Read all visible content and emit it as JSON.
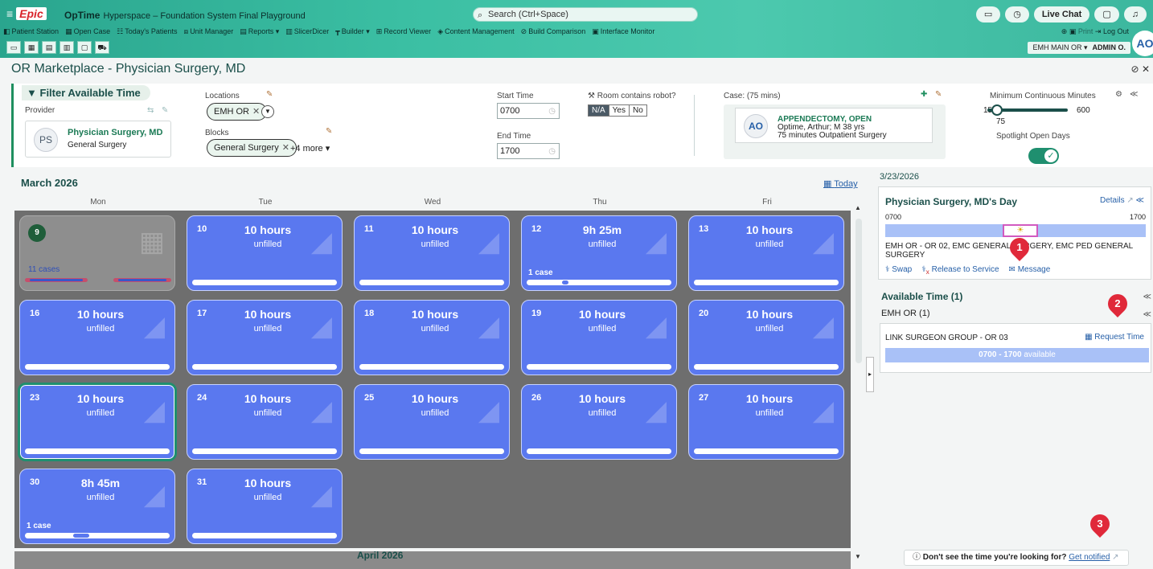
{
  "header": {
    "menu_icon": "≡",
    "logo": "Epic",
    "app_name": "OpTime",
    "app_subtitle": "Hyperspace – Foundation System Final Playground",
    "search_placeholder": "Search (Ctrl+Space)",
    "live_chat": "Live Chat",
    "nav": [
      "Patient Station",
      "Open Case",
      "Today's Patients",
      "Unit Manager",
      "Reports ▾",
      "SlicerDicer",
      "Builder ▾",
      "Record Viewer",
      "Content Management",
      "Build Comparison",
      "Interface Monitor"
    ],
    "print": "Print",
    "logout": "Log Out",
    "department": "EMH MAIN OR ▾",
    "user": "ADMIN O.",
    "avatar_initials": "AO"
  },
  "page": {
    "title": "OR Marketplace - Physician Surgery, MD"
  },
  "filter": {
    "title": "Filter Available Time",
    "provider_label": "Provider",
    "provider_initials": "PS",
    "provider_name": "Physician Surgery, MD",
    "provider_specialty": "General Surgery",
    "locations_label": "Locations",
    "location_chip": "EMH OR",
    "blocks_label": "Blocks",
    "block_chip": "General Surgery",
    "blocks_more": "+4 more ▾",
    "start_time_label": "Start Time",
    "start_time": "0700",
    "end_time_label": "End Time",
    "end_time": "1700",
    "robot_label": "Room contains robot?",
    "robot_options": [
      "N/A",
      "Yes",
      "No"
    ],
    "robot_selected": "N/A",
    "case_label": "Case: (75 mins)",
    "case_initials": "AO",
    "case_title": "APPENDECTOMY, OPEN",
    "case_patient": "Optime, Arthur; M 38 yrs",
    "case_detail": "75 minutes Outpatient Surgery",
    "min_cont_label": "Minimum Continuous Minutes",
    "min_value": "15",
    "max_value": "600",
    "current_value": "75",
    "slider_level": 0.12,
    "spotlight_label": "Spotlight Open Days",
    "spotlight_on": true
  },
  "calendar": {
    "month": "March 2026",
    "today": "Today",
    "weekdays": [
      "Mon",
      "Tue",
      "Wed",
      "Thu",
      "Fri"
    ],
    "days": [
      {
        "num": "9",
        "past": true,
        "cases": "11 cases"
      },
      {
        "num": "10",
        "hours": "10 hours",
        "status": "unfilled"
      },
      {
        "num": "11",
        "hours": "10 hours",
        "status": "unfilled"
      },
      {
        "num": "12",
        "hours": "9h 25m",
        "status": "unfilled",
        "cases": "1 case"
      },
      {
        "num": "13",
        "hours": "10 hours",
        "status": "unfilled"
      },
      {
        "num": "16",
        "hours": "10 hours",
        "status": "unfilled"
      },
      {
        "num": "17",
        "hours": "10 hours",
        "status": "unfilled"
      },
      {
        "num": "18",
        "hours": "10 hours",
        "status": "unfilled"
      },
      {
        "num": "19",
        "hours": "10 hours",
        "status": "unfilled"
      },
      {
        "num": "20",
        "hours": "10 hours",
        "status": "unfilled"
      },
      {
        "num": "23",
        "hours": "10 hours",
        "status": "unfilled",
        "selected": true
      },
      {
        "num": "24",
        "hours": "10 hours",
        "status": "unfilled"
      },
      {
        "num": "25",
        "hours": "10 hours",
        "status": "unfilled"
      },
      {
        "num": "26",
        "hours": "10 hours",
        "status": "unfilled"
      },
      {
        "num": "27",
        "hours": "10 hours",
        "status": "unfilled"
      },
      {
        "num": "30",
        "hours": "8h 45m",
        "status": "unfilled",
        "cases": "1 case"
      },
      {
        "num": "31",
        "hours": "10 hours",
        "status": "unfilled"
      }
    ],
    "next_month": "April 2026"
  },
  "sidebar": {
    "date": "3/23/2026",
    "day_title": "Physician Surgery, MD's Day",
    "details": "Details",
    "start": "0700",
    "end": "1700",
    "location_text": "EMH OR - OR 02, EMC GENERAL SURGERY, EMC PED GENERAL SURGERY",
    "swap": "Swap",
    "release": "Release to Service",
    "message": "Message",
    "available_title": "Available Time (1)",
    "emh_or": "EMH OR (1)",
    "slot_name": "LINK SURGEON GROUP - OR 03",
    "request_time": "Request Time",
    "slot_range": "0700 - 1700",
    "slot_available": "available",
    "dont_see": "Don't see the time you're looking for?",
    "get_notified": "Get notified"
  },
  "pins": [
    "1",
    "2",
    "3"
  ],
  "colors": {
    "header_teal": "#3bbfa3",
    "day_blue": "#5a78ef",
    "selected_green": "#1f8f6f",
    "link_blue": "#2760a8",
    "pin_red": "#e0293a"
  }
}
